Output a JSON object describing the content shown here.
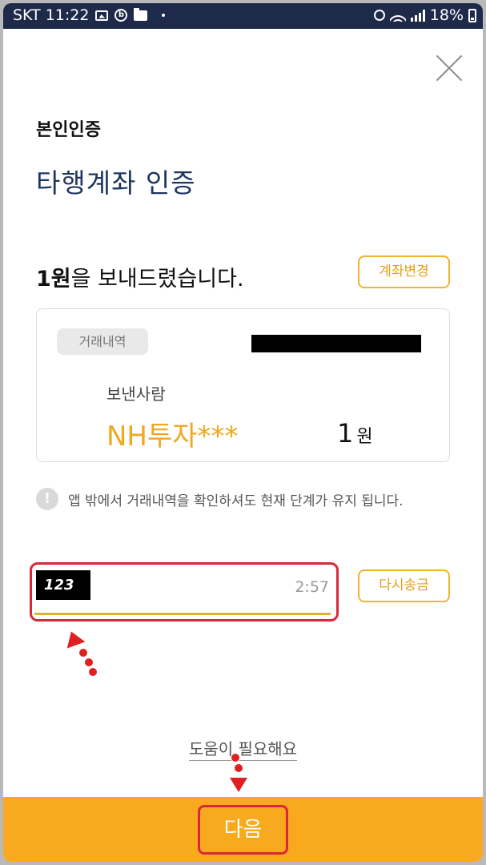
{
  "status_bar": {
    "carrier_time": "SKT 11:22",
    "battery": "18%"
  },
  "header": {
    "subtitle": "본인인증",
    "title": "타행계좌 인증"
  },
  "transfer": {
    "message_bold": "1원",
    "message_rest": "을 보내드렸습니다.",
    "change_account_label": "계좌변경"
  },
  "card": {
    "chip_label": "거래내역",
    "sender_label": "보낸사람",
    "sender_name": "NH투자***",
    "amount_value": "1",
    "amount_unit": "원"
  },
  "notice": {
    "icon_glyph": "!",
    "text": "앱 밖에서 거래내역을 확인하셔도 현재 단계가 유지 됩니다."
  },
  "code_input": {
    "value": "123",
    "timer": "2:57",
    "resend_label": "다시송금"
  },
  "help_label": "도움이 필요해요",
  "next_label": "다음",
  "colors": {
    "title_navy": "#1e3560",
    "accent_orange": "#f8a91d",
    "annotation_red": "#d8283a"
  }
}
